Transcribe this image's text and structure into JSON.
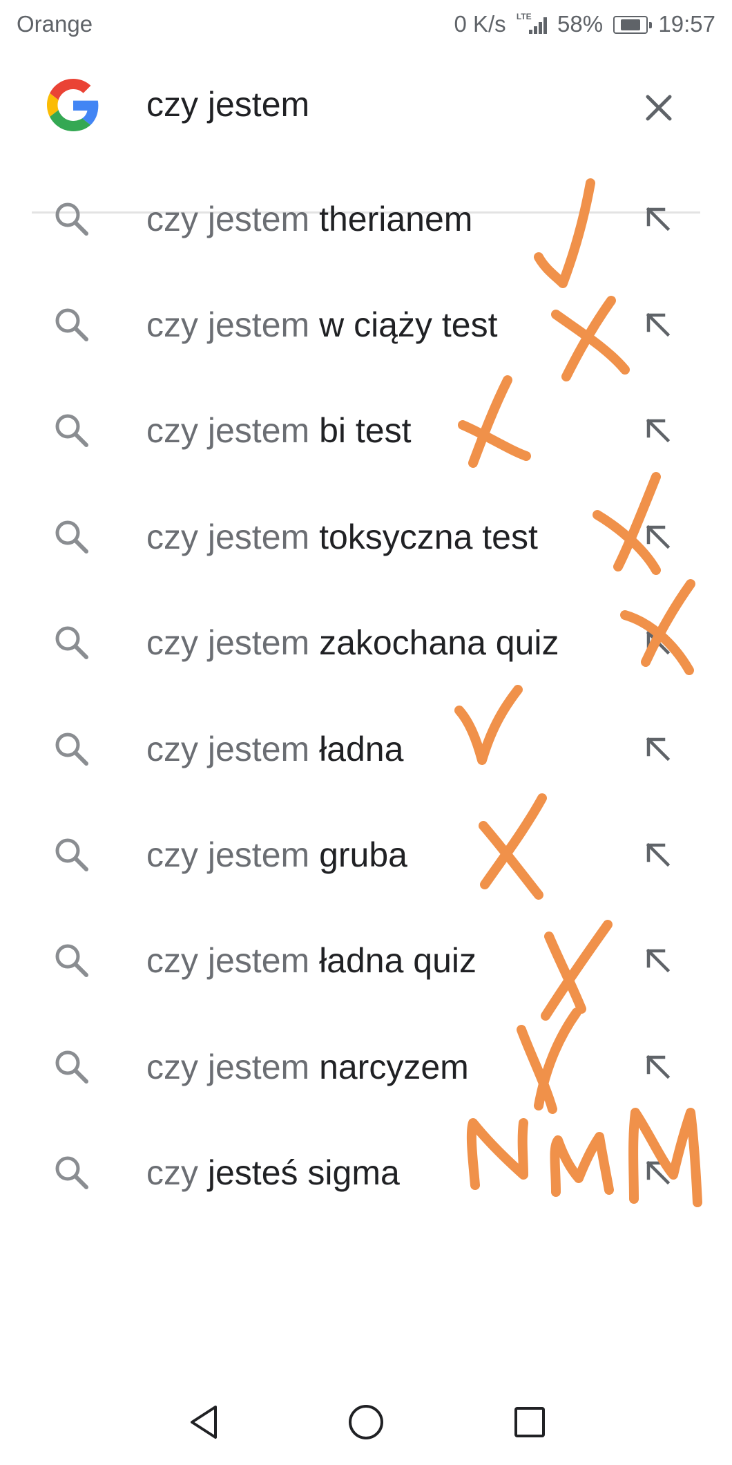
{
  "status_bar": {
    "carrier": "Orange",
    "network_speed": "0 K/s",
    "battery": "58%",
    "time": "19:57"
  },
  "search": {
    "query": "czy jestem",
    "logo_icon": "google-g-logo",
    "clear_icon": "close-icon"
  },
  "suggestions": [
    {
      "prefix": "czy jestem",
      "suffix": " therianem",
      "mark": "check"
    },
    {
      "prefix": "czy jestem",
      "suffix": " w ciąży test",
      "mark": "cross"
    },
    {
      "prefix": "czy jestem",
      "suffix": " bi test",
      "mark": "cross"
    },
    {
      "prefix": "czy jestem",
      "suffix": " toksyczna test",
      "mark": "cross"
    },
    {
      "prefix": "czy jestem",
      "suffix": " zakochana quiz",
      "mark": "cross"
    },
    {
      "prefix": "czy jestem",
      "suffix": " ładna",
      "mark": "check"
    },
    {
      "prefix": "czy jestem",
      "suffix": " gruba",
      "mark": "cross"
    },
    {
      "prefix": "czy jestem",
      "suffix": " ładna quiz",
      "mark": "cross"
    },
    {
      "prefix": "czy jestem",
      "suffix": " narcyzem",
      "mark": "cross"
    },
    {
      "prefix": "czy",
      "suffix": " jesteś sigma",
      "mark": "handwritten"
    }
  ],
  "annotations": {
    "color": "#f0914a",
    "handwritten_text": "NWM"
  },
  "nav_bar": {
    "icons": [
      "back-icon",
      "home-icon",
      "recents-icon"
    ]
  }
}
